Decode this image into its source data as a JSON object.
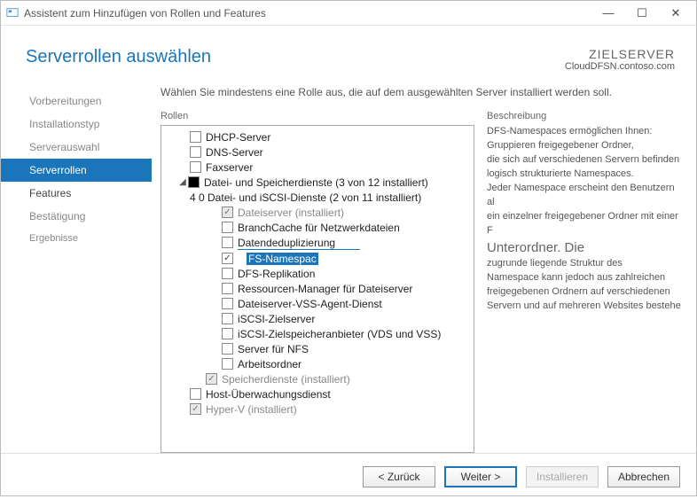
{
  "window": {
    "title": "Assistent zum Hinzufügen von Rollen und Features",
    "min": "—",
    "max": "☐",
    "close": "✕"
  },
  "header": {
    "title": "Serverrollen auswählen",
    "target_label": "ZIELSERVER",
    "target_value": "CloudDFSN.contoso.com"
  },
  "nav": {
    "items": [
      {
        "label": "Vorbereitungen"
      },
      {
        "label": "Installationstyp"
      },
      {
        "label": "Serverauswahl"
      },
      {
        "label": "Serverrollen"
      },
      {
        "label": "Features"
      },
      {
        "label": "Bestätigung"
      },
      {
        "label": "Ergebnisse"
      }
    ]
  },
  "instruction": "Wählen Sie mindestens eine Rolle aus, die auf dem ausgewählten Server installiert werden soll.",
  "roles_label": "Rollen",
  "desc_label": "Beschreibung",
  "tree": {
    "dhcp": "DHCP-Server",
    "dns": "DNS-Server",
    "fax": "Faxserver",
    "filestorage": "Datei- und Speicherdienste (3 von 12 installiert)",
    "fileiscsi": "4 0 Datei- und iSCSI-Dienste (2 von 11 installiert)",
    "fileserver": "Dateiserver (installiert)",
    "branchcache": "BranchCache für Netzwerkdateien",
    "dedup": "Datendeduplizierung",
    "dfsn_sel": "FS-Namespac",
    "dfsr": "DFS-Replikation",
    "fsrm": "Ressourcen-Manager für Dateiserver",
    "vss": "Dateiserver-VSS-Agent-Dienst",
    "iscsitarget": "iSCSI-Zielserver",
    "iscsivds": "iSCSI-Zielspeicheranbieter (VDS und VSS)",
    "nfs": "Server für NFS",
    "workfolders": "Arbeitsordner",
    "storageservices": "Speicherdienste (installiert)",
    "hostguardian": "Host-Überwachungsdienst",
    "hyperv": "Hyper-V (installiert)"
  },
  "description": {
    "l1": "DFS-Namespaces ermöglichen Ihnen:",
    "l2": "Gruppieren freigegebener Ordner,",
    "l3": " die sich auf verschiedenen Servern befinden",
    "l4": "logisch strukturierte Namespaces.",
    "l5": "Jeder Namespace erscheint den Benutzern al",
    "l6": "ein einzelner freigegebener Ordner mit einer F",
    "big": "Unterordner. Die",
    "l7": "zugrunde liegende Struktur des",
    "l8": "Namespace kann jedoch aus zahlreichen",
    "l9": "freigegebenen Ordnern auf verschiedenen",
    "l10": "Servern und auf mehreren Websites bestehe"
  },
  "buttons": {
    "back": "< Zurück",
    "next": "Weiter >",
    "install": "Installieren",
    "cancel": "Abbrechen"
  }
}
